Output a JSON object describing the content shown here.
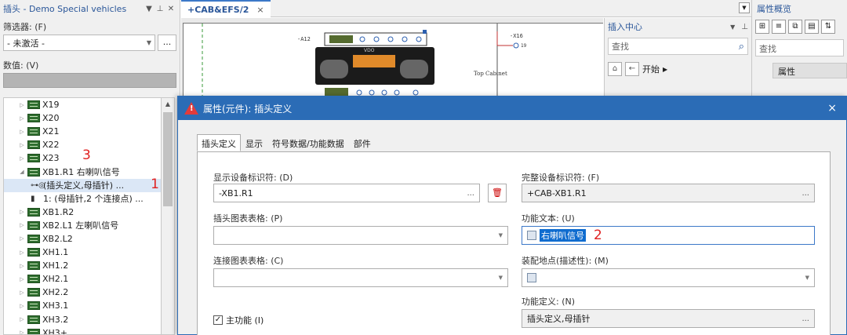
{
  "left_panel": {
    "title": "插头 - Demo Special vehicles",
    "filter_label": "筛选器: (F)",
    "filter_value": "- 未激活 -",
    "filter_more": "...",
    "value_label": "数值: (V)",
    "tree": [
      {
        "label": "X19",
        "level": 1
      },
      {
        "label": "X20",
        "level": 1
      },
      {
        "label": "X21",
        "level": 1
      },
      {
        "label": "X22",
        "level": 1
      },
      {
        "label": "X23",
        "level": 1
      },
      {
        "label": "XB1.R1 右喇叭信号",
        "level": 1,
        "expanded": true
      },
      {
        "label": "(插头定义,母插针) ...",
        "level": 2,
        "selected": true
      },
      {
        "label": "1: (母插针,2 个连接点) ...",
        "level": 2
      },
      {
        "label": "XB1.R2",
        "level": 1
      },
      {
        "label": "XB2.L1 左喇叭信号",
        "level": 1
      },
      {
        "label": "XB2.L2",
        "level": 1
      },
      {
        "label": "XH1.1",
        "level": 1
      },
      {
        "label": "XH1.2",
        "level": 1
      },
      {
        "label": "XH2.1",
        "level": 1
      },
      {
        "label": "XH2.2",
        "level": 1
      },
      {
        "label": "XH3.1",
        "level": 1
      },
      {
        "label": "XH3.2",
        "level": 1
      },
      {
        "label": "XH3+",
        "level": 1
      }
    ],
    "annotation_1": "1",
    "annotation_3": "3"
  },
  "center": {
    "tab_label": "+CAB&EFS/2",
    "tab_close": "×",
    "schematic": {
      "device_a12": "-A12",
      "device_x16": "-X16",
      "pin_x16": "19",
      "cabinet_label": "Top Cabinet",
      "radio_brand": "VDO"
    }
  },
  "insert_center": {
    "title": "插入中心",
    "search_placeholder": "查找",
    "nav_start": "开始"
  },
  "property_overview": {
    "title": "属性概览",
    "search_placeholder": "查找",
    "column_header": "属性"
  },
  "dialog": {
    "title": "属性(元件): 插头定义",
    "close": "×",
    "tabs": [
      "插头定义",
      "显示",
      "符号数据/功能数据",
      "部件"
    ],
    "fields": {
      "display_id_label": "显示设备标识符: (D)",
      "display_id_value": "-XB1.R1",
      "full_id_label": "完整设备标识符: (F)",
      "full_id_value": "+CAB-XB1.R1",
      "plug_table_label": "插头图表表格: (P)",
      "function_text_label": "功能文本: (U)",
      "function_text_value": "右喇叭信号",
      "annotation_2": "2",
      "conn_table_label": "连接图表表格: (C)",
      "mount_location_label": "装配地点(描述性): (M)",
      "function_def_label": "功能定义: (N)",
      "function_def_value": "插头定义,母插针",
      "main_function_label": "主功能 (I)",
      "more": "..."
    }
  },
  "colors": {
    "dialog_title_bg": "#2b6cb6",
    "highlight": "#0f6ccf",
    "annotation_red": "#e02020",
    "tree_selection": "#dbe7f6"
  }
}
